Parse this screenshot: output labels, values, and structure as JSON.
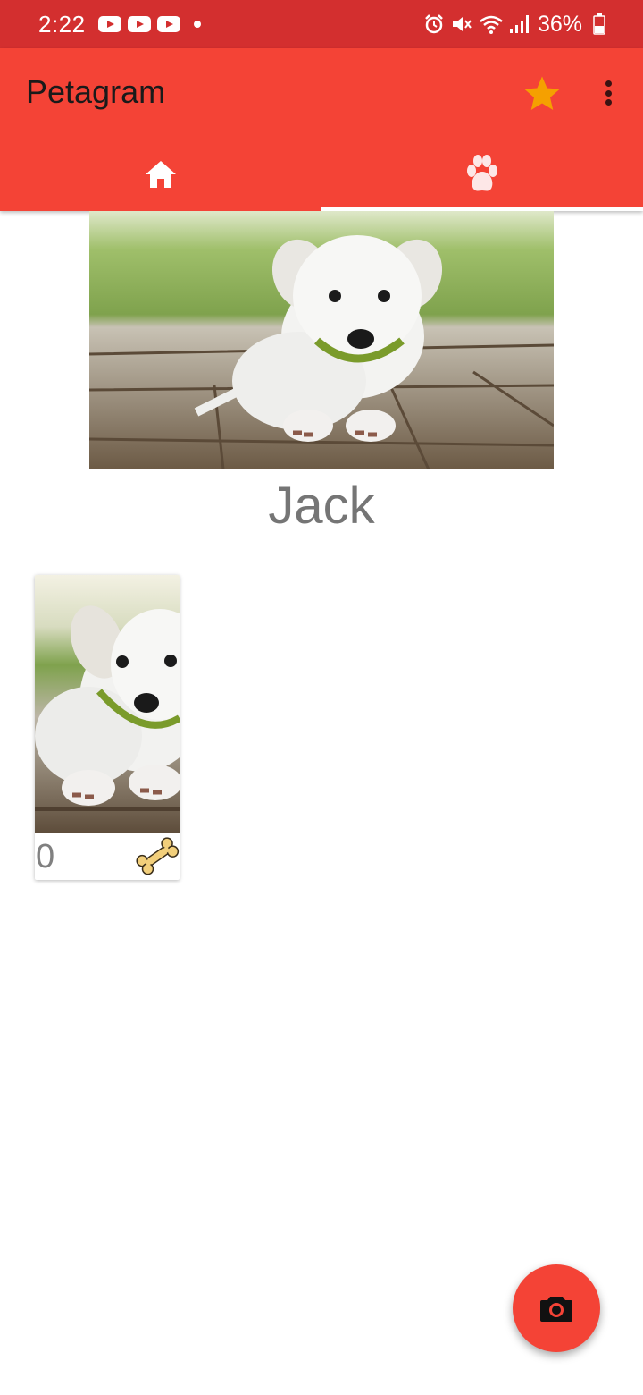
{
  "status_bar": {
    "time": "2:22",
    "notification_icons": [
      "youtube-icon",
      "youtube-icon",
      "youtube-icon",
      "dot-icon"
    ],
    "system_icons": [
      "alarm-icon",
      "mute-icon",
      "wifi-icon",
      "signal-icon"
    ],
    "battery_percent": "36%"
  },
  "app_bar": {
    "title": "Petagram",
    "actions": [
      "star-icon",
      "more-vert-icon"
    ]
  },
  "tabs": [
    {
      "icon": "home-icon",
      "selected": false
    },
    {
      "icon": "paw-icon",
      "selected": true
    }
  ],
  "profile": {
    "name": "Jack"
  },
  "pets": [
    {
      "likes": "0",
      "like_icon": "bone-icon"
    }
  ],
  "fab": {
    "icon": "camera-icon"
  },
  "colors": {
    "status_bar": "#d32f2f",
    "primary": "#f44336",
    "accent_star": "#f5a000",
    "text_secondary": "#757575"
  }
}
